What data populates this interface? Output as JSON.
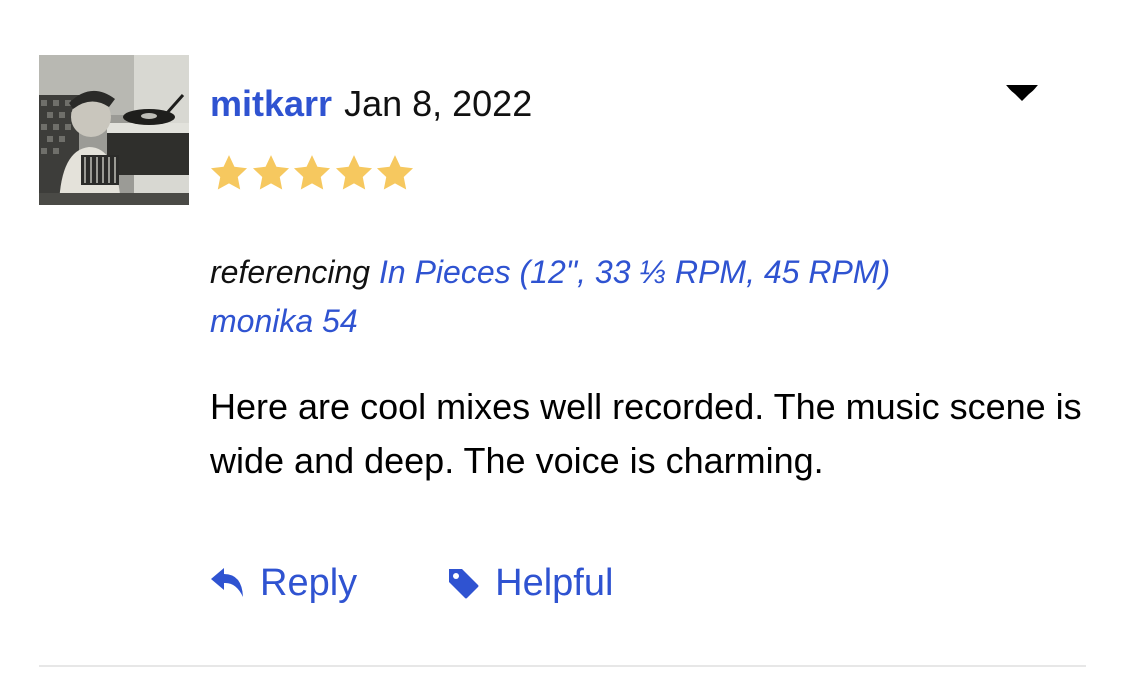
{
  "review": {
    "username": "mitkarr",
    "date": "Jan 8, 2022",
    "rating": 5,
    "rating_max": 5,
    "referencing_label": "referencing",
    "referenced_release": "In Pieces (12\", 33 ⅓ RPM, 45 RPM)",
    "referenced_artist": "monika 54",
    "body": "Here are cool mixes well recorded. The music scene is wide and deep. The voice is charming."
  },
  "actions": {
    "reply_label": "Reply",
    "helpful_label": "Helpful"
  },
  "icons": {
    "menu": "chevron-down-icon",
    "reply": "reply-arrow-icon",
    "helpful": "tag-icon",
    "star": "star-icon"
  },
  "colors": {
    "link": "#2f53d1",
    "star": "#f6c85f",
    "text": "#000000",
    "divider": "#e7e7e7"
  }
}
